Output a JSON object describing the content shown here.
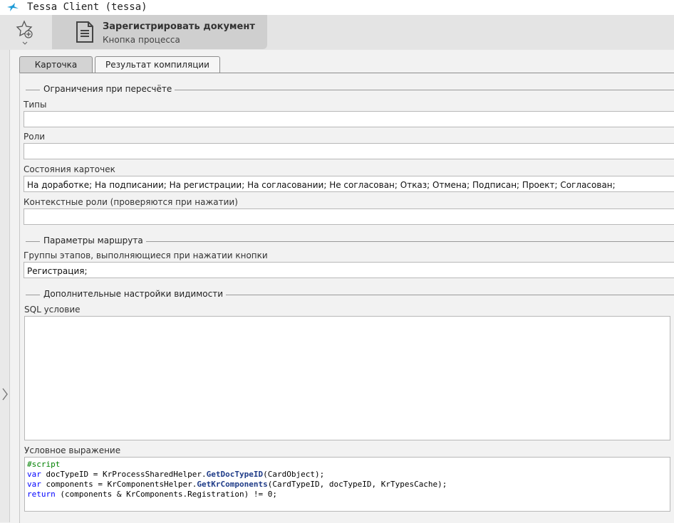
{
  "window": {
    "title": "Tessa Client (tessa)"
  },
  "toolbar": {
    "process_button": {
      "title": "Зарегистрировать документ",
      "subtitle": "Кнопка процесса"
    }
  },
  "tabs": [
    {
      "label": "Карточка",
      "active": true
    },
    {
      "label": "Результат компиляции",
      "active": false
    }
  ],
  "sections": {
    "restrictions": "Ограничения при пересчёте",
    "route": "Параметры маршрута",
    "visibility": "Дополнительные настройки видимости"
  },
  "fields": {
    "types": {
      "label": "Типы",
      "value": ""
    },
    "roles": {
      "label": "Роли",
      "value": ""
    },
    "card_states": {
      "label": "Состояния карточек",
      "value": "На доработке; На подписании; На регистрации; На согласовании; Не согласован; Отказ; Отмена; Подписан; Проект; Согласован;"
    },
    "context_roles": {
      "label": "Контекстные роли (проверяются при нажатии)",
      "value": ""
    },
    "stage_groups": {
      "label": "Группы этапов, выполняющиеся при нажатии кнопки",
      "value": "Регистрация;"
    },
    "sql_condition": {
      "label": "SQL условие",
      "value": ""
    },
    "condition_expr": {
      "label": "Условное выражение",
      "code": {
        "line1": "#script",
        "line2_kw": "var",
        "line2_a": " docTypeID = KrProcessSharedHelper.",
        "line2_m": "GetDocTypeID",
        "line2_b": "(CardObject);",
        "line3_kw": "var",
        "line3_a": " components = KrComponentsHelper.",
        "line3_m": "GetKrComponents",
        "line3_b": "(CardTypeID, docTypeID, KrTypesCache);",
        "line4_kw": "return",
        "line4_a": " (components & KrComponents.Registration) != 0;"
      }
    }
  },
  "icons": {
    "app": "tessa-bird-icon",
    "favorites": "star-add-icon",
    "document": "document-icon",
    "expand": "chevron-right-icon"
  },
  "colors": {
    "accent": "#1f9bd7",
    "keyword": "#0000ff",
    "directive": "#008000"
  }
}
